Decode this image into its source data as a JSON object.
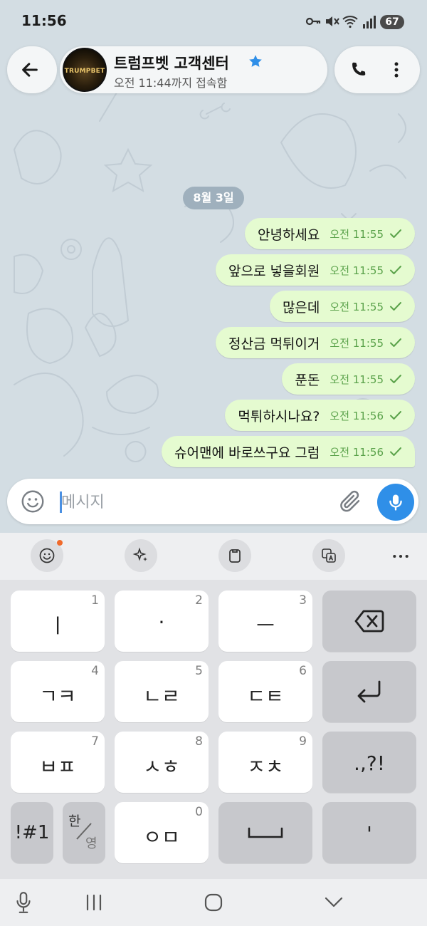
{
  "status_bar": {
    "time": "11:56",
    "battery": "67"
  },
  "header": {
    "avatar_text": "TRUMPBET",
    "title": "트럼프벳 고객센터",
    "status": "오전 11:44까지 접속함"
  },
  "chat": {
    "date": "8월 3일",
    "messages": [
      {
        "text": "안녕하세요",
        "time": "오전 11:55"
      },
      {
        "text": "앞으로 넣을회원",
        "time": "오전 11:55"
      },
      {
        "text": "많은데",
        "time": "오전 11:55"
      },
      {
        "text": "정산금 먹튀이거",
        "time": "오전 11:55"
      },
      {
        "text": "푼돈",
        "time": "오전 11:55"
      },
      {
        "text": "먹튀하시나요?",
        "time": "오전 11:56"
      },
      {
        "text": "슈어맨에 바로쓰구요 그럼",
        "time": "오전 11:56"
      }
    ]
  },
  "input": {
    "placeholder": "메시지"
  },
  "keyboard": {
    "rows": [
      [
        {
          "label": "ㅣ",
          "num": "1"
        },
        {
          "label": "·",
          "num": "2"
        },
        {
          "label": "ㅡ",
          "num": "3"
        },
        {
          "label": "",
          "num": ""
        }
      ],
      [
        {
          "label": "ㄱㅋ",
          "num": "4"
        },
        {
          "label": "ㄴㄹ",
          "num": "5"
        },
        {
          "label": "ㄷㅌ",
          "num": "6"
        },
        {
          "label": "",
          "num": ""
        }
      ],
      [
        {
          "label": "ㅂㅍ",
          "num": "7"
        },
        {
          "label": "ㅅㅎ",
          "num": "8"
        },
        {
          "label": "ㅈㅊ",
          "num": "9"
        },
        {
          "label": ".,?!",
          "num": ""
        }
      ]
    ],
    "symbols_key": "!#1",
    "lang_key_top": "한",
    "lang_key_bottom": "영",
    "key_0": {
      "label": "ㅇㅁ",
      "num": "0"
    },
    "apostrophe_key": "'"
  }
}
